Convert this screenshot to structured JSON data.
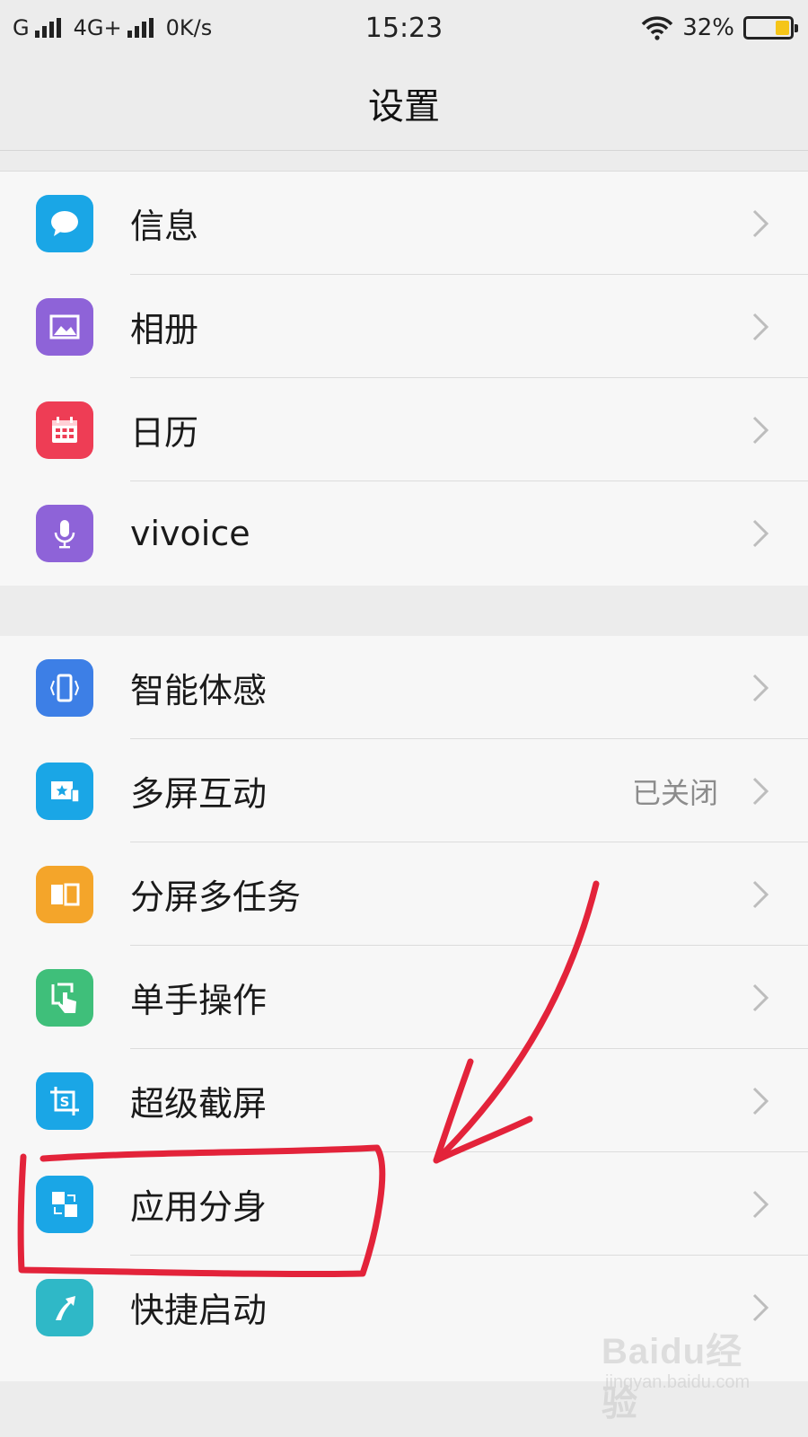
{
  "status_bar": {
    "carrier1": "G",
    "carrier2": "4G+",
    "speed": "0K/s",
    "time": "15:23",
    "battery": "32%",
    "battery_level": 0.32
  },
  "header": {
    "title": "设置"
  },
  "group1": [
    {
      "label": "信息",
      "icon": "message-icon",
      "color": "#1aa6e6"
    },
    {
      "label": "相册",
      "icon": "album-icon",
      "color": "#8e63d8"
    },
    {
      "label": "日历",
      "icon": "calendar-icon",
      "color": "#ee3d55"
    },
    {
      "label": "vivoice",
      "icon": "microphone-icon",
      "color": "#8e63d8"
    }
  ],
  "group2": [
    {
      "label": "智能体感",
      "icon": "smart-motion-icon",
      "color": "#3d7fe6"
    },
    {
      "label": "多屏互动",
      "icon": "multi-screen-icon",
      "color": "#1aa6e6",
      "value": "已关闭"
    },
    {
      "label": "分屏多任务",
      "icon": "split-screen-icon",
      "color": "#f4a52a"
    },
    {
      "label": "单手操作",
      "icon": "one-hand-icon",
      "color": "#3fbf7a"
    },
    {
      "label": "超级截屏",
      "icon": "screenshot-icon",
      "color": "#1aa6e6"
    },
    {
      "label": "应用分身",
      "icon": "app-clone-icon",
      "color": "#1aa6e6"
    },
    {
      "label": "快捷启动",
      "icon": "quick-launch-icon",
      "color": "#2fb8c7"
    }
  ],
  "watermark": {
    "main": "Baidu经验",
    "sub": "jingyan.baidu.com"
  }
}
